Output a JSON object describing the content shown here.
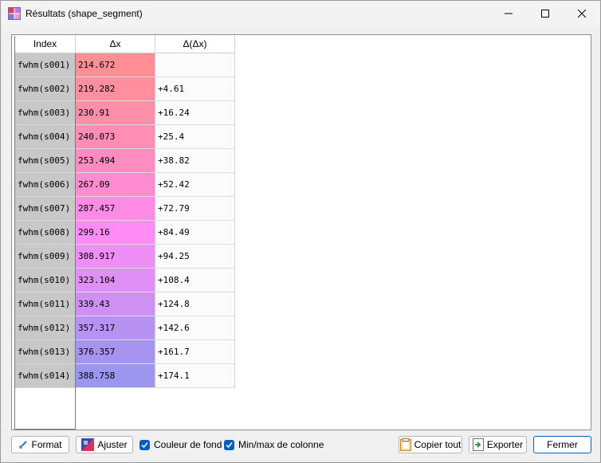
{
  "window": {
    "title": "Résultats (shape_segment)"
  },
  "table": {
    "headers": [
      "Index",
      "Δx",
      "Δ(Δx)"
    ],
    "rows": [
      {
        "index": "fwhm(s001)",
        "dx": "214.672",
        "ddx": "",
        "color": "#ff8f95"
      },
      {
        "index": "fwhm(s002)",
        "dx": "219.282",
        "ddx": "+4.61",
        "color": "#ff8e9e"
      },
      {
        "index": "fwhm(s003)",
        "dx": "230.91",
        "ddx": "+16.24",
        "color": "#ff8ea8"
      },
      {
        "index": "fwhm(s004)",
        "dx": "240.073",
        "ddx": "+25.4",
        "color": "#ff8db4"
      },
      {
        "index": "fwhm(s005)",
        "dx": "253.494",
        "ddx": "+38.82",
        "color": "#ff8cc1"
      },
      {
        "index": "fwhm(s006)",
        "dx": "267.09",
        "ddx": "+52.42",
        "color": "#ff8cd0"
      },
      {
        "index": "fwhm(s007)",
        "dx": "287.457",
        "ddx": "+72.79",
        "color": "#ff8be4"
      },
      {
        "index": "fwhm(s008)",
        "dx": "299.16",
        "ddx": "+84.49",
        "color": "#ff8cf5"
      },
      {
        "index": "fwhm(s009)",
        "dx": "308.917",
        "ddx": "+94.25",
        "color": "#f08ef7"
      },
      {
        "index": "fwhm(s010)",
        "dx": "323.104",
        "ddx": "+108.4",
        "color": "#e08ff5"
      },
      {
        "index": "fwhm(s011)",
        "dx": "339.43",
        "ddx": "+124.8",
        "color": "#cf90f3"
      },
      {
        "index": "fwhm(s012)",
        "dx": "357.317",
        "ddx": "+142.6",
        "color": "#b892f2"
      },
      {
        "index": "fwhm(s013)",
        "dx": "376.357",
        "ddx": "+161.7",
        "color": "#a494f0"
      },
      {
        "index": "fwhm(s014)",
        "dx": "388.758",
        "ddx": "+174.1",
        "color": "#9c96ef"
      }
    ]
  },
  "toolbar": {
    "format_label": "Format",
    "adjust_label": "Ajuster",
    "bg_color_label": "Couleur de fond",
    "bg_color_checked": true,
    "minmax_label": "Min/max de colonne",
    "minmax_checked": true,
    "copy_all_label": "Copier tout",
    "export_label": "Exporter",
    "close_label": "Fermer"
  },
  "colors": {
    "accent": "#005fb8",
    "index_bg": "#c8c8c8"
  }
}
